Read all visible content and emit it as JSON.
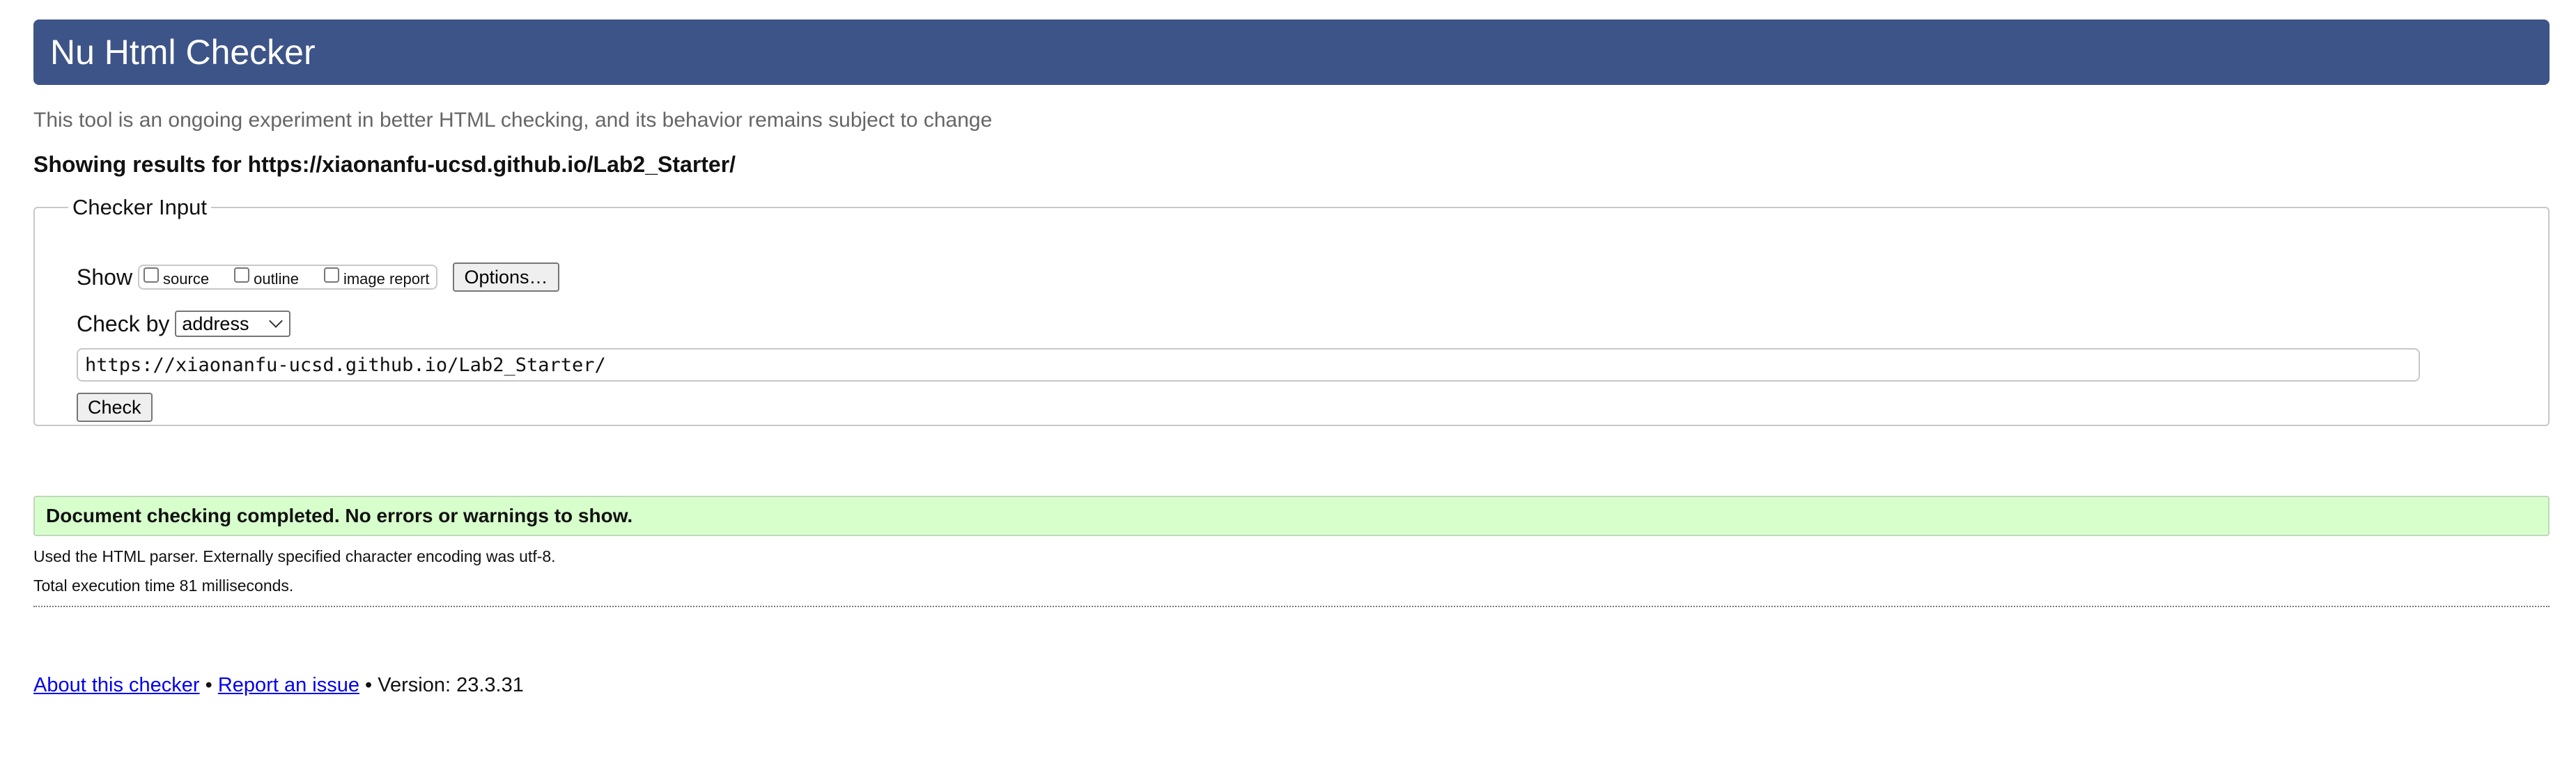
{
  "header": {
    "title": "Nu Html Checker"
  },
  "tagline": "This tool is an ongoing experiment in better HTML checking, and its behavior remains subject to change",
  "results_for": "Showing results for https://xiaonanfu-ucsd.github.io/Lab2_Starter/",
  "checker_input": {
    "legend": "Checker Input",
    "show_label": "Show",
    "options": [
      {
        "label": "source",
        "checked": false
      },
      {
        "label": "outline",
        "checked": false
      },
      {
        "label": "image report",
        "checked": false
      }
    ],
    "options_button": "Options…",
    "check_by_label": "Check by",
    "check_by_selected": "address",
    "url_value": "https://xiaonanfu-ucsd.github.io/Lab2_Starter/",
    "check_button": "Check"
  },
  "result": {
    "message": "Document checking completed. No errors or warnings to show.",
    "parser_info": "Used the HTML parser. Externally specified character encoding was utf-8.",
    "execution_time": "Total execution time 81 milliseconds."
  },
  "footer": {
    "about_link": "About this checker",
    "separator": "•",
    "report_link": "Report an issue",
    "version": "Version: 23.3.31"
  },
  "colors": {
    "header_bg": "#3d5488",
    "success_bg": "#d7ffcc",
    "link": "#0000ee"
  }
}
